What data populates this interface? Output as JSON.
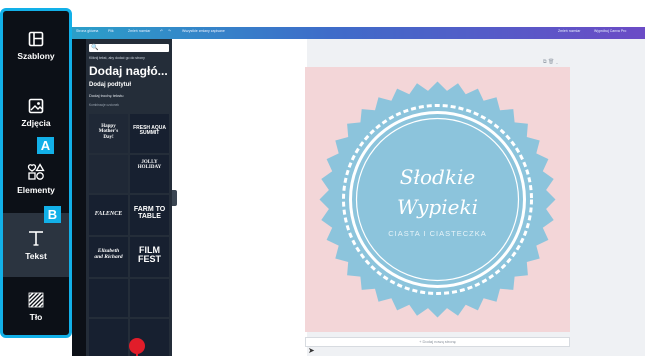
{
  "topbar": {
    "items": [
      "Strona główna",
      "Plik",
      "Zmień rozmiar",
      "↶",
      "↷",
      "Wszystkie zmiany zapisane"
    ],
    "right": [
      "Zmień rozmiar",
      "Wypróbuj Canva Pro"
    ]
  },
  "rail": {
    "items": [
      {
        "label": "Szablony",
        "icon": "layout-icon"
      },
      {
        "label": "Zdjęcia",
        "icon": "image-icon"
      },
      {
        "label": "Elementy",
        "icon": "shapes-icon"
      },
      {
        "label": "Tekst",
        "icon": "text-icon"
      },
      {
        "label": "Tło",
        "icon": "pattern-icon"
      }
    ],
    "badges": [
      "A",
      "B"
    ],
    "highlight_color": "#12b0e8"
  },
  "panel": {
    "search_icon": "🔍",
    "note": "Kliknij tekst, aby dodać go do strony",
    "heading": "Dodaj nagłó...",
    "subheading": "Dodaj podtytuł",
    "body": "Dodaj trochę tekstu",
    "section": "Kombinacje czcionek",
    "tiles": [
      [
        "Happy",
        "Mother's",
        "Day!"
      ],
      [
        "FRESH AQUA",
        "SUMMIT"
      ],
      [
        "JOLLY",
        "HOLIDAY"
      ],
      [
        "FALENCE"
      ],
      [
        "FARM TO",
        "TABLE"
      ],
      [
        "Elizabeth",
        "and Richard"
      ],
      [
        "FILM",
        "FEST"
      ]
    ]
  },
  "canvas": {
    "page_actions": "⧉  🗑  ⌄",
    "title_line1": "Słodkie",
    "title_line2": "Wypieki",
    "subtitle": "CIASTA I CIASTECZKA",
    "add_page": "+ Dodaj nową stronę",
    "page_bg": "#f3d6d8",
    "badge_color": "#8cc4dc"
  }
}
